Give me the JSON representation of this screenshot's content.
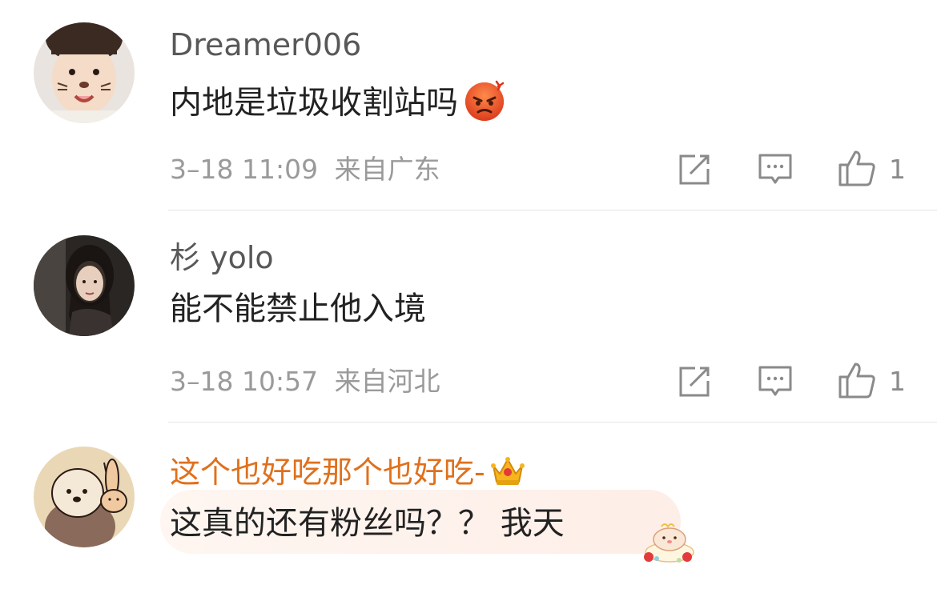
{
  "comments": [
    {
      "username": "Dreamer006",
      "text": "内地是垃圾收割站吗",
      "time": "3–18 11:09",
      "location": "来自广东",
      "likes": "1",
      "emoji": "angry-face-icon"
    },
    {
      "username": "杉 yolo",
      "text": "能不能禁止他入境",
      "time": "3–18 10:57",
      "location": "来自河北",
      "likes": "1"
    },
    {
      "username": "这个也好吃那个也好吃-",
      "text": "这真的还有粉丝吗？？ 我天",
      "badge": "crown-icon",
      "username_color": "#e0701c",
      "sticker": "hamster-cake-sticker-icon"
    }
  ],
  "colors": {
    "username": "#585858",
    "vip_username": "#e0701c",
    "text": "#222222",
    "meta": "#9a9a9a",
    "divider": "#e6e6e6"
  }
}
